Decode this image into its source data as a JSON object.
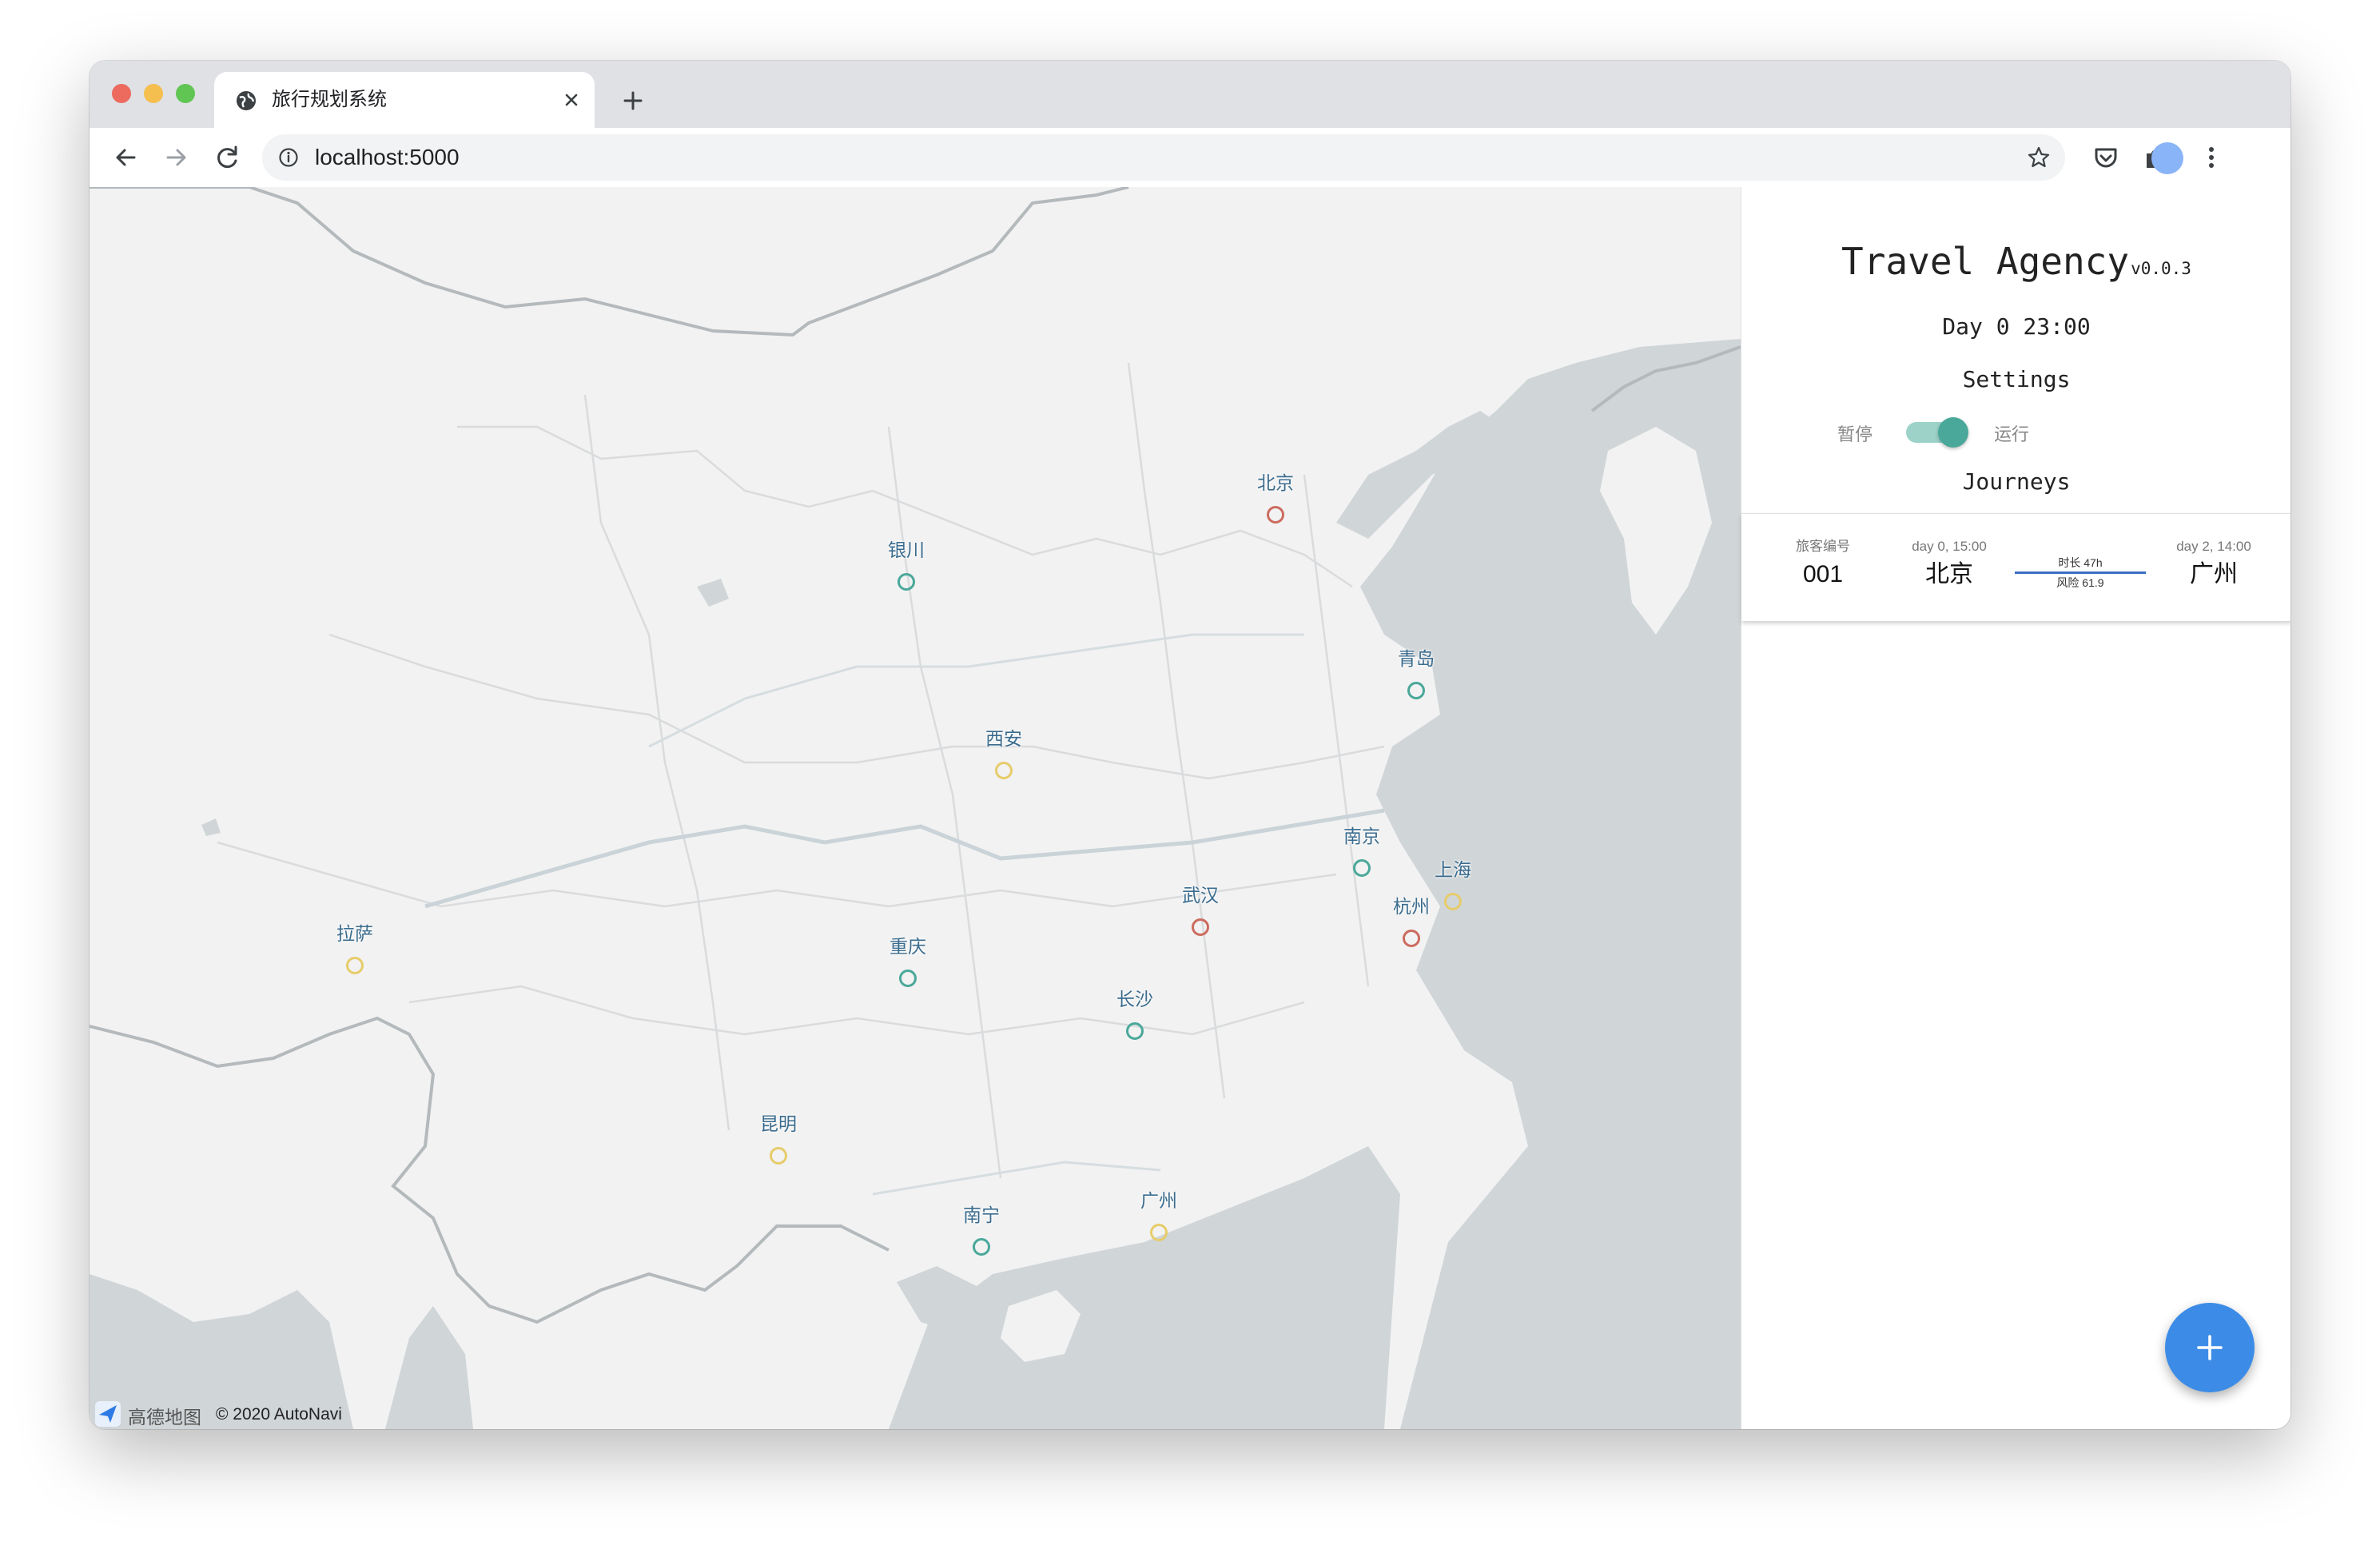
{
  "browser": {
    "tab_title": "旅行规划系统",
    "url": "localhost:5000"
  },
  "map": {
    "cities": [
      {
        "name": "北京",
        "status": "red"
      },
      {
        "name": "银川",
        "status": "teal"
      },
      {
        "name": "青岛",
        "status": "teal"
      },
      {
        "name": "西安",
        "status": "yellow"
      },
      {
        "name": "南京",
        "status": "teal"
      },
      {
        "name": "上海",
        "status": "yellow"
      },
      {
        "name": "武汉",
        "status": "red"
      },
      {
        "name": "杭州",
        "status": "red"
      },
      {
        "name": "拉萨",
        "status": "yellow"
      },
      {
        "name": "重庆",
        "status": "teal"
      },
      {
        "name": "长沙",
        "status": "teal"
      },
      {
        "name": "昆明",
        "status": "yellow"
      },
      {
        "name": "南宁",
        "status": "teal"
      },
      {
        "name": "广州",
        "status": "yellow"
      }
    ],
    "status_colors": {
      "red": "#cc6b5f",
      "teal": "#4aa89a",
      "yellow": "#e6cc6a"
    },
    "attribution_brand": "高德地图",
    "attribution_copy": "© 2020 AutoNavi"
  },
  "panel": {
    "title": "Travel Agency",
    "version": "v0.0.3",
    "clock": "Day 0 23:00",
    "settings_heading": "Settings",
    "toggle_off_label": "暂停",
    "toggle_on_label": "运行",
    "toggle_state": "on",
    "journeys_heading": "Journeys",
    "journeys": [
      {
        "passenger_label": "旅客编号",
        "passenger_id": "001",
        "depart_time": "day 0, 15:00",
        "from": "北京",
        "duration": "时长 47h",
        "risk": "风险 61.9",
        "arrive_time": "day 2, 14:00",
        "to": "广州"
      }
    ],
    "fab_icon": "plus-icon",
    "accent": "#3c8ce7"
  }
}
